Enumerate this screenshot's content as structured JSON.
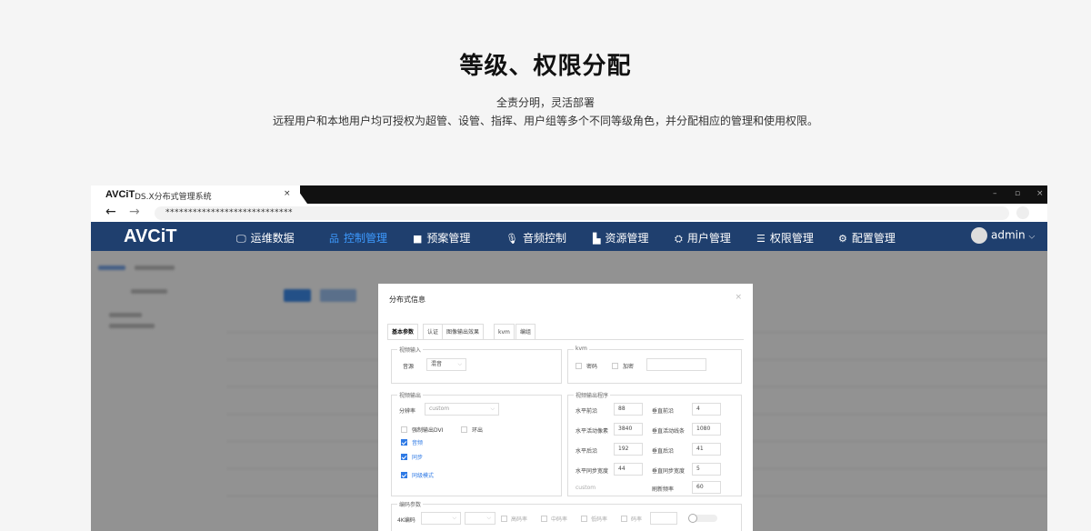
{
  "hero": {
    "title": "等级、权限分配",
    "subtitle": "全责分明，灵活部署",
    "description": "远程用户和本地用户均可授权为超管、设管、指挥、用户组等多个不同等级角色，并分配相应的管理和使用权限。"
  },
  "browser": {
    "tab_logo": "AVCiT",
    "tab_title": "DS.X分布式管理系统",
    "tab_close": "×",
    "window_controls": [
      "–",
      "▫",
      "×"
    ],
    "back": "←",
    "forward": "→",
    "url": "****************************"
  },
  "app": {
    "logo": "AVCiT",
    "nav": [
      {
        "icon": "monitor-icon",
        "glyph": "🖵",
        "label": "运维数据"
      },
      {
        "icon": "network-icon",
        "glyph": "品",
        "label": "控制管理",
        "active": true
      },
      {
        "icon": "grid-icon",
        "glyph": "■",
        "label": "预案管理"
      },
      {
        "icon": "mic-icon",
        "glyph": "🎙",
        "label": "音频控制"
      },
      {
        "icon": "folder-icon",
        "glyph": "▙",
        "label": "资源管理"
      },
      {
        "icon": "users-icon",
        "glyph": "⛭",
        "label": "用户管理"
      },
      {
        "icon": "sliders-icon",
        "glyph": "☰",
        "label": "权限管理"
      },
      {
        "icon": "settings-icon",
        "glyph": "⚙",
        "label": "配置管理"
      }
    ],
    "user": "admin",
    "user_chevron": "⌵",
    "accent": "#1f3f6e",
    "active_color": "#3d9aff"
  },
  "modal": {
    "title": "分布式信息",
    "close": "×",
    "tabs": [
      "基本参数",
      "认证",
      "图像输出效果",
      "kvm",
      "编组"
    ],
    "video_input": {
      "legend": "视频输入",
      "source_label": "音源",
      "source_value": "混音"
    },
    "kvm": {
      "legend": "kvm",
      "password_label": "密码",
      "encrypt_label": "加密"
    },
    "video_output": {
      "legend": "视频输出",
      "resolution_label": "分辨率",
      "resolution_value": "custom",
      "force_dvi": "强制输出DVI",
      "loop_out": "环出",
      "audio": "音频",
      "sync": "同步",
      "sync_mode": "同级模式"
    },
    "timing": {
      "legend": "视频输出程序",
      "rows": [
        {
          "l1": "水平前沿",
          "v1": "88",
          "l2": "垂直前沿",
          "v2": "4"
        },
        {
          "l1": "水平活动像素",
          "v1": "3840",
          "l2": "垂直活动线条",
          "v2": "1080"
        },
        {
          "l1": "水平后沿",
          "v1": "192",
          "l2": "垂直后沿",
          "v2": "41"
        },
        {
          "l1": "水平同步宽度",
          "v1": "44",
          "l2": "垂直同步宽度",
          "v2": "5"
        }
      ],
      "custom_label": "custom",
      "refresh_label": "刷新频率",
      "refresh_value": "60"
    },
    "encoding": {
      "legend": "编码参数",
      "label_4k": "4K编码",
      "options": [
        "高码率",
        "中码率",
        "低码率",
        "码率"
      ]
    }
  }
}
